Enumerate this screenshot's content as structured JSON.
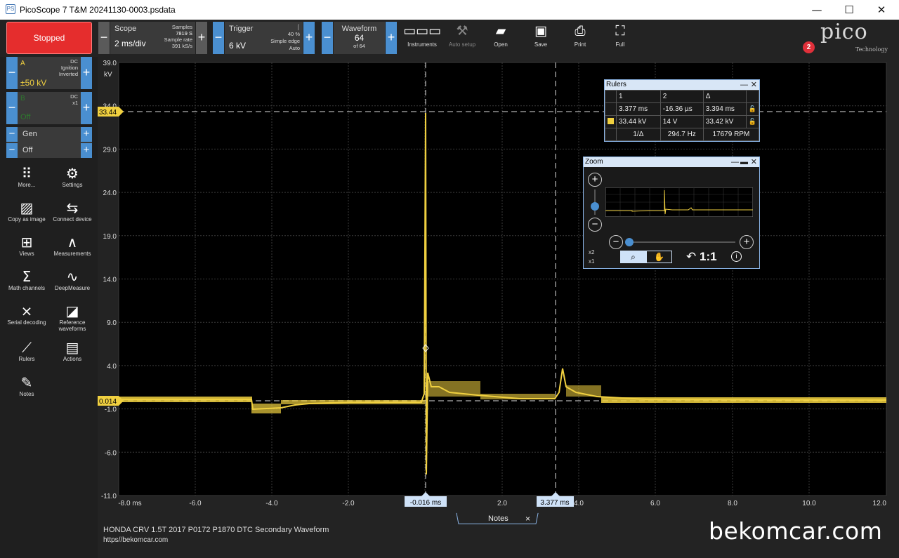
{
  "window": {
    "app_icon": "PS",
    "title": "PicoScope 7 T&M 20241130-0003.psdata",
    "minimize": "—",
    "maximize": "☐",
    "close": "✕"
  },
  "toolbar": {
    "stopped_label": "Stopped",
    "scope": {
      "minus": "−",
      "plus": "+",
      "label": "Scope",
      "value": "2 ms/div",
      "samples_label": "Samples",
      "samples_value": "7819 S",
      "rate_label": "Sample rate",
      "rate_value": "391 kS/s"
    },
    "trigger": {
      "minus": "−",
      "plus": "+",
      "label": "Trigger",
      "value": "6 kV",
      "pct": "40 %",
      "type": "Simple edge",
      "mode": "Auto"
    },
    "waveform": {
      "minus": "−",
      "plus": "+",
      "label": "Waveform",
      "value": "64",
      "of": "of 64"
    },
    "buttons": {
      "instruments": "Instruments",
      "autosetup": "Auto setup",
      "open": "Open",
      "save": "Save",
      "print": "Print",
      "full": "Full"
    }
  },
  "logo": {
    "text": "pico",
    "sub": "Technology",
    "badge": "2"
  },
  "channels": {
    "a": {
      "minus": "−",
      "plus": "+",
      "name": "A",
      "coupling": "DC",
      "probe": "Ignition",
      "inv": "Inverted",
      "range": "±50 kV"
    },
    "b": {
      "minus": "−",
      "plus": "+",
      "name": "B",
      "coupling": "DC",
      "probe": "x1",
      "range": "Off"
    },
    "gen": {
      "minus1": "−",
      "plus1": "+",
      "minus2": "−",
      "plus2": "+",
      "label": "Gen",
      "value": "Off"
    }
  },
  "tools": {
    "more": "More...",
    "settings": "Settings",
    "copy": "Copy as image",
    "connect": "Connect device",
    "views": "Views",
    "measurements": "Measurements",
    "math": "Math channels",
    "deep": "DeepMeasure",
    "serial": "Serial decoding",
    "ref": "Reference waveforms",
    "rulers": "Rulers",
    "actions": "Actions",
    "notes": "Notes"
  },
  "plot": {
    "y_unit": "kV",
    "y_ticks": [
      "39.0",
      "34.0",
      "29.0",
      "24.0",
      "19.0",
      "14.0",
      "9.0",
      "4.0",
      "-1.0",
      "-6.0",
      "-11.0"
    ],
    "x_ticks": [
      "-8.0 ms",
      "-6.0",
      "-4.0",
      "-2.0",
      "2.0",
      "4.0",
      "6.0",
      "8.0",
      "10.0",
      "12.0"
    ],
    "ruler_h1": "33.44",
    "ruler_h2": "0.014",
    "ruler_v1": "-0.016 ms",
    "ruler_v2": "3.377 ms",
    "trace_color": "#f0d040"
  },
  "rulers_window": {
    "title": "Rulers",
    "headers": [
      "1",
      "2",
      "Δ"
    ],
    "row_time": [
      "3.377 ms",
      "-16.36 µs",
      "3.394 ms"
    ],
    "row_volt": [
      "33.44 kV",
      "14 V",
      "33.42 kV"
    ],
    "row_freq": {
      "label": "1/Δ",
      "hz": "294.7 Hz",
      "rpm": "17679 RPM"
    }
  },
  "zoom_window": {
    "title": "Zoom",
    "x2": "x2",
    "x1": "x1",
    "ratio": "1:1",
    "plus": "+",
    "minus": "−"
  },
  "notes": {
    "tab": "Notes",
    "close": "×",
    "line1": "HONDA CRV 1.5T 2017 P0172 P1870 DTC Secondary Waveform",
    "line2": "https//bekomcar.com"
  },
  "watermark": "bekomcar.com"
}
